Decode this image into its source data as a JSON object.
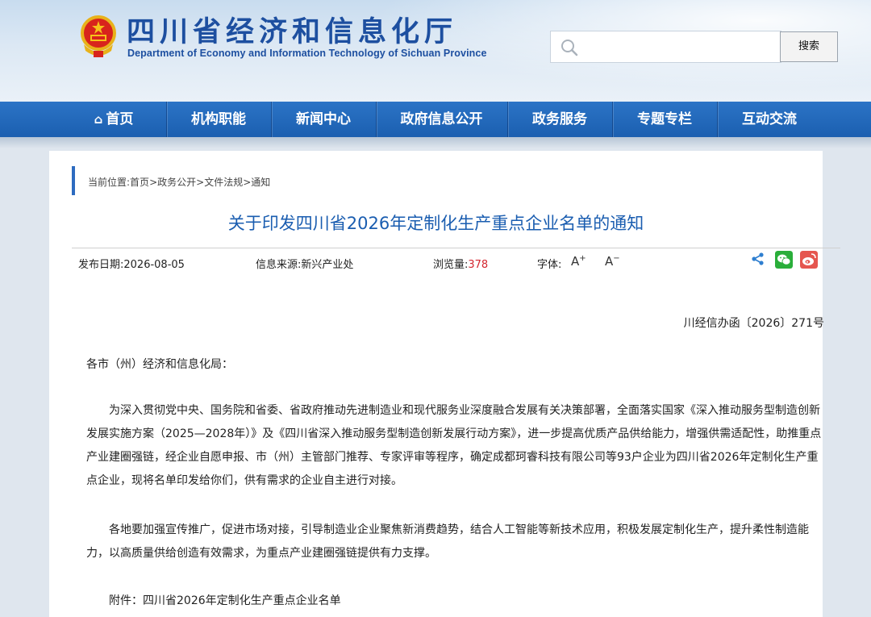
{
  "header": {
    "title": "四川省经济和信息化厅",
    "subtitle": "Department of Economy and Information Technology of Sichuan Province",
    "search_placeholder": "",
    "search_button": "搜索"
  },
  "nav": {
    "items": [
      {
        "label": "首页",
        "icon": "home-icon"
      },
      {
        "label": "机构职能"
      },
      {
        "label": "新闻中心"
      },
      {
        "label": "政府信息公开"
      },
      {
        "label": "政务服务"
      },
      {
        "label": "专题专栏"
      },
      {
        "label": "互动交流"
      }
    ]
  },
  "breadcrumb": {
    "prefix": "当前位置:",
    "items": [
      "首页",
      "政务公开",
      "文件法规",
      "通知"
    ],
    "separator": ">"
  },
  "article": {
    "title": "关于印发四川省2026年定制化生产重点企业名单的通知",
    "publish_date": "发布日期:2026-08-05",
    "source": "信息来源:新兴产业处",
    "views_label": "浏览量:",
    "views": "378",
    "font_label": "字体:",
    "font_increase": "A",
    "font_decrease": "A",
    "doc_number": "川经信办函〔2026〕271号",
    "salutation": "各市（州）经济和信息化局：",
    "paragraph1": "为深入贯彻党中央、国务院和省委、省政府推动先进制造业和现代服务业深度融合发展有关决策部署，全面落实国家《深入推动服务型制造创新发展实施方案（2025—2028年）》及《四川省深入推动服务型制造创新发展行动方案》，进一步提高优质产品供给能力，增强供需适配性，助推重点产业建圈强链，经企业自愿申报、市（州）主管部门推荐、专家评审等程序，确定成都珂睿科技有限公司等93户企业为四川省2026年定制化生产重点企业，现将名单印发给你们，供有需求的企业自主进行对接。",
    "paragraph2": "各地要加强宣传推广，促进市场对接，引导制造业企业聚焦新消费趋势，结合人工智能等新技术应用，积极发展定制化生产，提升柔性制造能力，以高质量供给创造有效需求，为重点产业建圈强链提供有力支撑。",
    "attachment": "附件：四川省2026年定制化生产重点企业名单"
  },
  "colors": {
    "brand_blue": "#1d4fa0",
    "nav_blue": "#1f63b5",
    "title_blue": "#1a5db0",
    "view_count_red": "#d3262f",
    "wechat_green": "#2aae3a",
    "weibo_red": "#e5564f"
  }
}
